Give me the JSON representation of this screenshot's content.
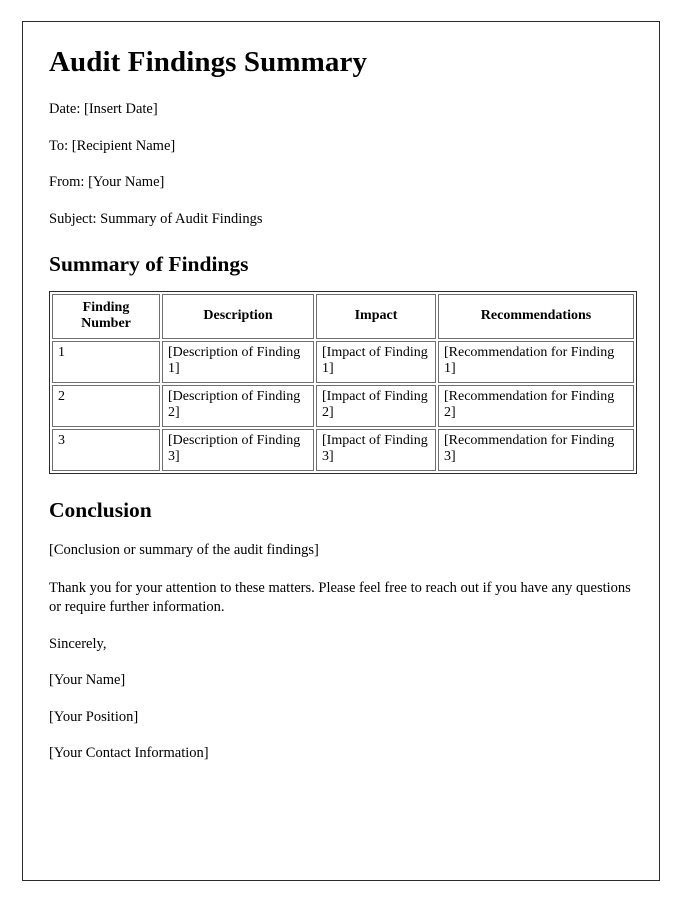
{
  "document": {
    "title": "Audit Findings Summary",
    "meta": [
      {
        "label": "Date",
        "text": "Date: [Insert Date]"
      },
      {
        "label": "To",
        "text": "To: [Recipient Name]"
      },
      {
        "label": "From",
        "text": "From: [Your Name]"
      },
      {
        "label": "Subject",
        "text": "Subject: Summary of Audit Findings"
      }
    ],
    "summary_section": {
      "heading": "Summary of Findings",
      "table": {
        "columns": [
          "Finding Number",
          "Description",
          "Impact",
          "Recommendations"
        ],
        "rows": [
          {
            "number": "1",
            "description": "[Description of Finding 1]",
            "impact": "[Impact of Finding 1]",
            "recommendation": "[Recommendation for Finding 1]"
          },
          {
            "number": "2",
            "description": "[Description of Finding 2]",
            "impact": "[Impact of Finding 2]",
            "recommendation": "[Recommendation for Finding 2]"
          },
          {
            "number": "3",
            "description": "[Description of Finding 3]",
            "impact": "[Impact of Finding 3]",
            "recommendation": "[Recommendation for Finding 3]"
          }
        ]
      }
    },
    "conclusion_section": {
      "heading": "Conclusion",
      "placeholder": "[Conclusion or summary of the audit findings]",
      "thanks": "Thank you for your attention to these matters. Please feel free to reach out if you have any questions or require further information."
    },
    "signature": [
      "Sincerely,",
      "[Your Name]",
      "[Your Position]",
      "[Your Contact Information]"
    ]
  },
  "colors": {
    "text": "#000000",
    "page_border": "#2b2b2b",
    "table_cell_border": "#6f6f6f",
    "background": "#ffffff"
  }
}
